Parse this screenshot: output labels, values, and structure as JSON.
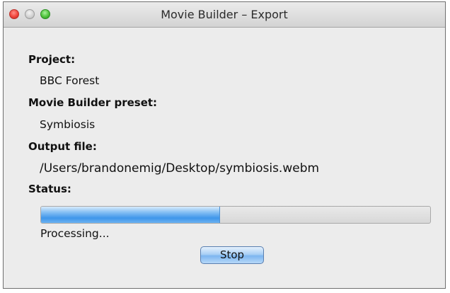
{
  "window": {
    "title": "Movie Builder – Export"
  },
  "fields": {
    "project_label": "Project:",
    "project_value": "BBC Forest",
    "preset_label": "Movie Builder preset:",
    "preset_value": "Symbiosis",
    "output_label": "Output file:",
    "output_value": "/Users/brandonemig/Desktop/symbiosis.webm",
    "status_label": "Status:",
    "status_text": "Processing..."
  },
  "progress": {
    "fraction": 0.46
  },
  "buttons": {
    "stop_label": "Stop"
  },
  "colors": {
    "close": "#f0433a",
    "minimize": "#cfcfcf",
    "maximize": "#4fc23c",
    "progress_fill": "#3f96ea",
    "stop_button": "#a9cff5"
  }
}
